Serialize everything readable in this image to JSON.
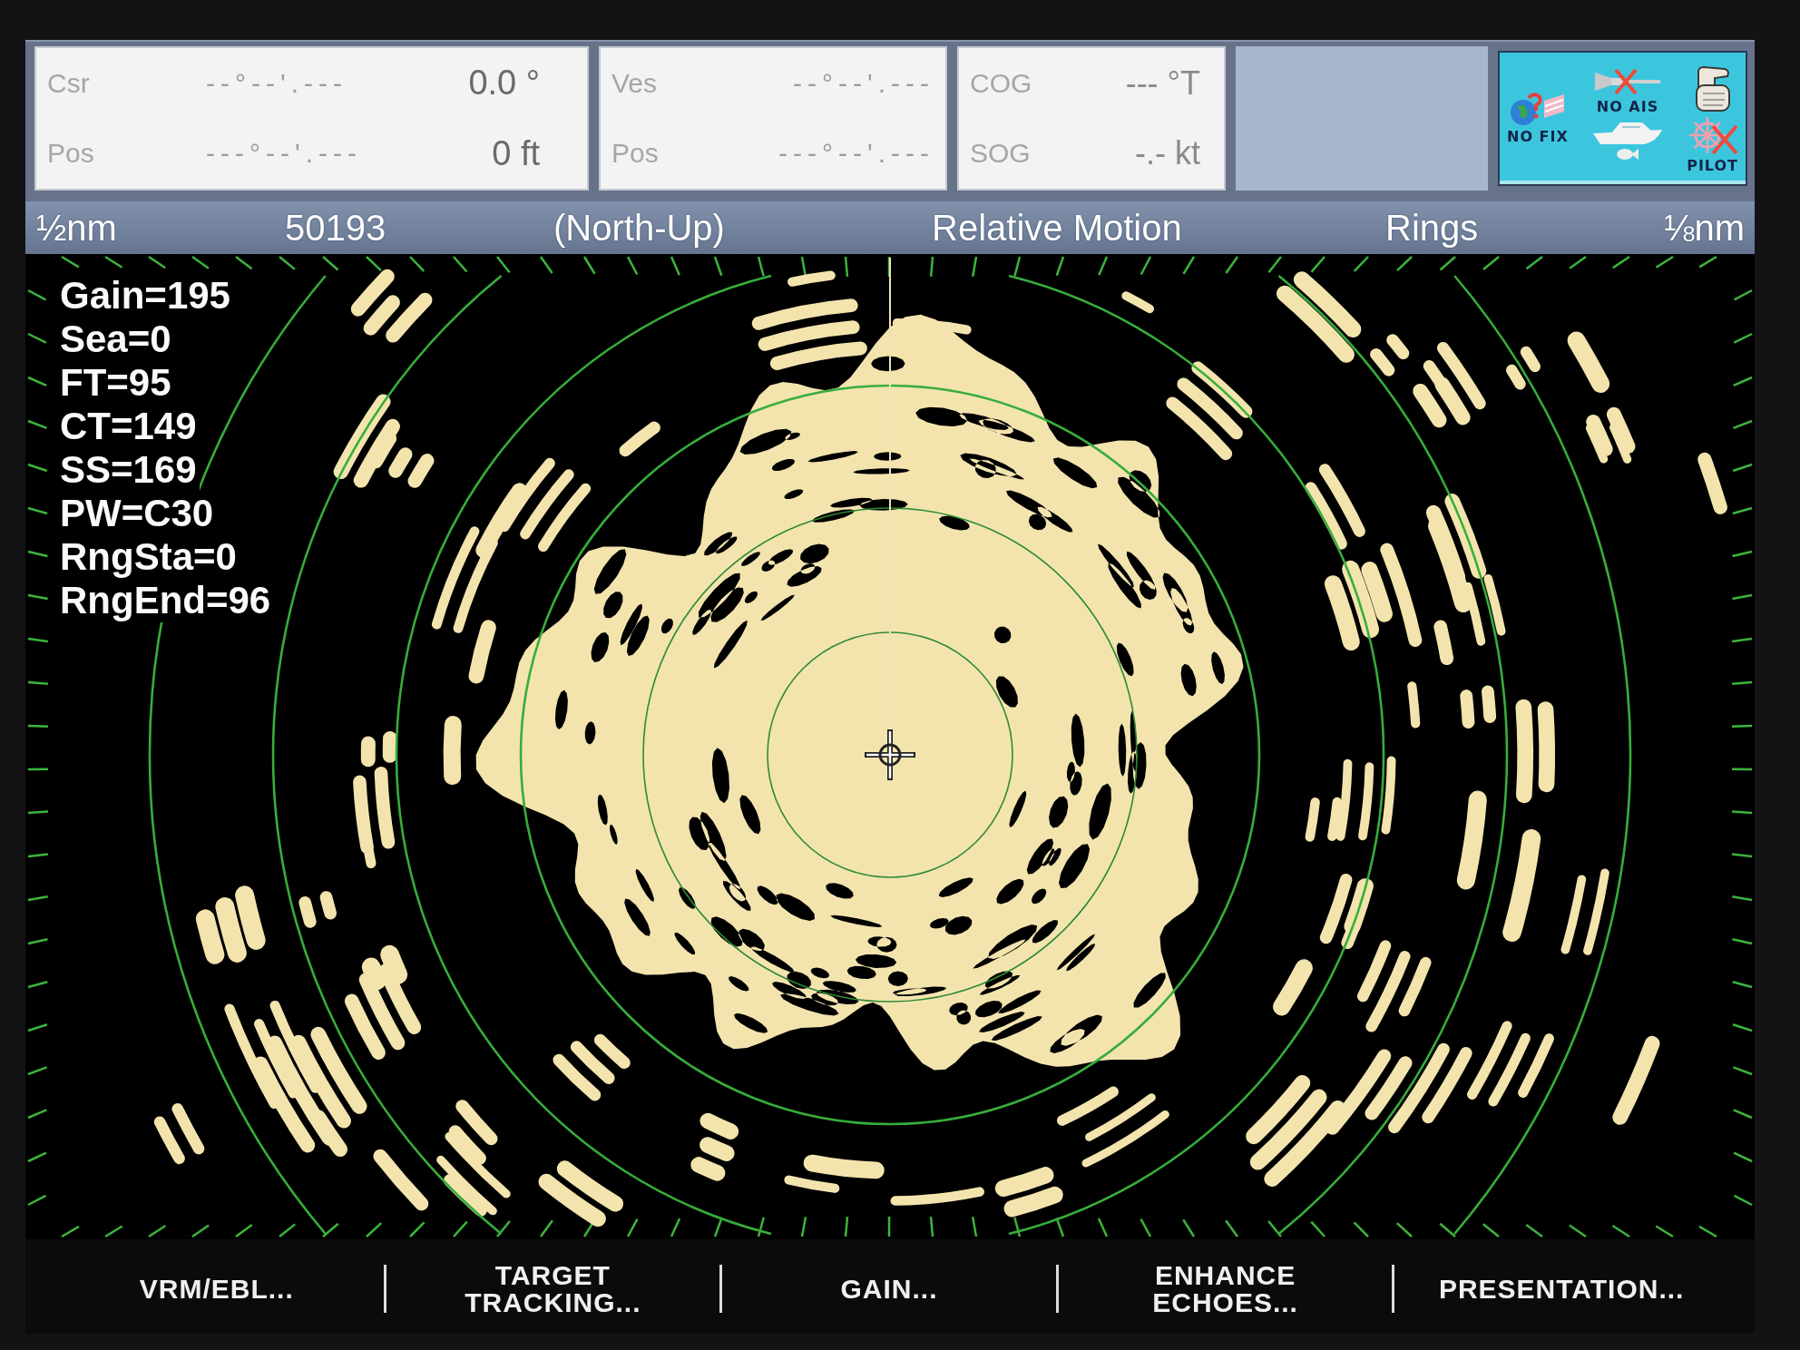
{
  "info_bar": {
    "panels": [
      {
        "rows": [
          {
            "label": "Csr",
            "position": "--°--'.---",
            "value": "0.0 °"
          },
          {
            "label": "Pos",
            "position": "---°--'.---",
            "value": "0 ft"
          }
        ]
      },
      {
        "rows": [
          {
            "label": "Ves",
            "position": "--°--'.---"
          },
          {
            "label": "Pos",
            "position": "---°--'.---"
          }
        ]
      },
      {
        "rows": [
          {
            "label": "COG",
            "value": "--- °T"
          },
          {
            "label": "SOG",
            "value": "-.- kt"
          }
        ]
      }
    ],
    "status_indicators": [
      {
        "kind": "ais",
        "label": "NO AIS"
      },
      {
        "kind": "hand"
      },
      {
        "kind": "gps",
        "label": "NO FIX"
      },
      {
        "kind": "boat"
      },
      {
        "kind": "pilot",
        "label": "PILOT"
      },
      {
        "kind": "fish"
      }
    ]
  },
  "status_bar": {
    "fields": [
      "½nm",
      "50193",
      "(North-Up)",
      "Relative Motion",
      "Rings",
      "⅛nm"
    ]
  },
  "radar": {
    "settings": [
      "Gain=195",
      "Sea=0",
      "FT=95",
      "CT=149",
      "SS=169",
      "PW=C30",
      "RngSta=0",
      "RngEnd=96"
    ]
  },
  "softkeys": [
    "VRM/EBL...",
    "TARGET TRACKING...",
    "GAIN...",
    "ENHANCE ECHOES...",
    "PRESENTATION..."
  ]
}
